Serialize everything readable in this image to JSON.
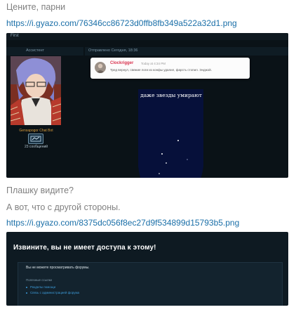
{
  "post": {
    "line1": "Цените, парни",
    "link1": "https://i.gyazo.com/76346cc86723d0ffb8fb349a522a32d1.png",
    "line2": "Плашку видите?",
    "line3": "А вот, что с другой стороны.",
    "link2": "https://i.gyazo.com/8375dc056f8ec27d9f534899d15793b5.png"
  },
  "shot1": {
    "topbar_title": "First",
    "col_author": "Ассистент",
    "col_posted": "Отправлено Сегодня, 18:36",
    "author_name": "Gensapogor Chat Bot",
    "author_posts": "23 сообщений",
    "notif_user": "Clockrigger",
    "notif_time": "Today at 4:34 PM",
    "notif_text": "Тред вернул, свежие логи из конфы удалил, фарсть стопил. Энджой.",
    "caption": "даже звезды умирают"
  },
  "shot2": {
    "title": "Извините, вы не имеет доступа к этому!",
    "message": "Вы не можете просматривать форумы.",
    "section": "Полезные ссылки",
    "links": [
      "Разделы помощи",
      "Связь с администрацией форума"
    ]
  },
  "colors": {
    "link": "#1a6fa8",
    "dark_bg": "#0a1217",
    "notif_name": "#d9334f",
    "night_sky": "#06103a"
  }
}
